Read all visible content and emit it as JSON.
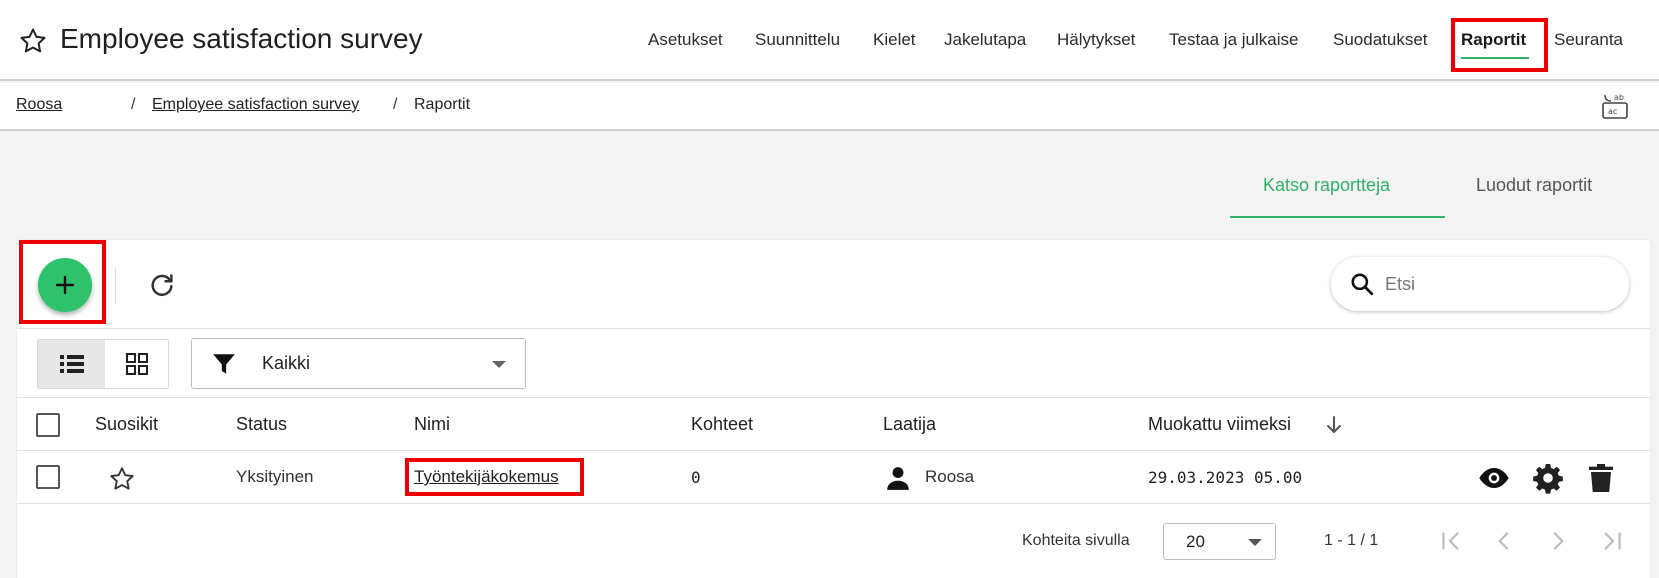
{
  "header": {
    "title": "Employee satisfaction survey",
    "nav": [
      {
        "label": "Asetukset"
      },
      {
        "label": "Suunnittelu"
      },
      {
        "label": "Kielet"
      },
      {
        "label": "Jakelutapa"
      },
      {
        "label": "Hälytykset"
      },
      {
        "label": "Testaa ja julkaise"
      },
      {
        "label": "Suodatukset"
      },
      {
        "label": "Raportit",
        "active": true
      },
      {
        "label": "Seuranta"
      }
    ]
  },
  "breadcrumb": {
    "items": [
      {
        "label": "Roosa"
      },
      {
        "label": "Employee satisfaction survey"
      },
      {
        "label": "Raportit"
      }
    ],
    "separator": "/"
  },
  "tabs": {
    "active": "Katso raportteja",
    "inactive": "Luodut raportit"
  },
  "toolbar": {
    "add_icon": "plus-icon",
    "refresh_icon": "refresh-icon",
    "search_placeholder": "Etsi"
  },
  "filter": {
    "selected": "Kaikki"
  },
  "table": {
    "columns": [
      "Suosikit",
      "Status",
      "Nimi",
      "Kohteet",
      "Laatija",
      "Muokattu viimeksi"
    ],
    "rows": [
      {
        "status": "Yksityinen",
        "name": "Työntekijäkokemus",
        "items": "0",
        "author": "Roosa",
        "modified": "29.03.2023 05.00",
        "actions": [
          "eye-icon",
          "gear-icon",
          "trash-icon"
        ]
      }
    ]
  },
  "pagination": {
    "label": "Kohteita sivulla",
    "per_page": "20",
    "range": "1 - 1 / 1"
  },
  "colors": {
    "accent_green": "#2fb168",
    "fab_green": "#2ec36b",
    "highlight_red": "#ee0000"
  }
}
